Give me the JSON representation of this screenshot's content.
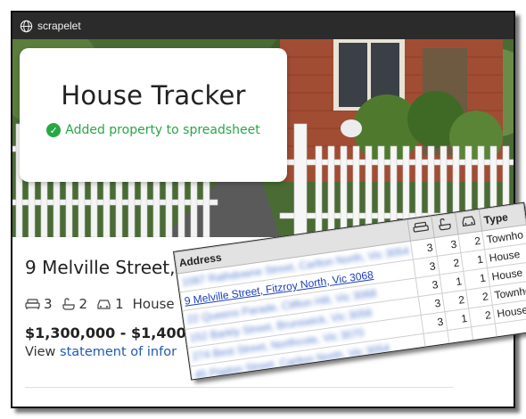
{
  "app": {
    "name": "scrapelet"
  },
  "card": {
    "title": "House Tracker",
    "status": "Added property to spreadsheet"
  },
  "listing": {
    "address": "9 Melville Street, Fitzroy North, Vi",
    "bedrooms": "3",
    "bathrooms": "2",
    "parking": "1",
    "type": "House",
    "price": "$1,300,000 - $1,400,",
    "statement_prefix": "View ",
    "statement_link": "statement of infor"
  },
  "spreadsheet": {
    "headers": {
      "address": "Address",
      "type": "Type"
    },
    "header_icons": [
      "bed-icon",
      "bath-icon",
      "car-icon"
    ],
    "rows": [
      {
        "address": "1087 Rathdowne Street, Carlton North, Vic 3054",
        "beds": "3",
        "baths": "3",
        "cars": "2",
        "type": "Townho",
        "blurred": true
      },
      {
        "address": "9 Melville Street, Fitzroy North, Vic 3068",
        "beds": "3",
        "baths": "2",
        "cars": "1",
        "type": "House",
        "blurred": false
      },
      {
        "address": "22 Queens Parade, Clifton Hill, Vic 3068",
        "beds": "3",
        "baths": "1",
        "cars": "1",
        "type": "House",
        "blurred": true
      },
      {
        "address": "152 Barkly Street, Brunswick, Vic 3056",
        "beds": "3",
        "baths": "2",
        "cars": "2",
        "type": "Townho",
        "blurred": true
      },
      {
        "address": "274 Best Street, Northcote, Vic 3070",
        "beds": "3",
        "baths": "1",
        "cars": "2",
        "type": "House",
        "blurred": true
      },
      {
        "address": "45 Pigdon Street, Carlton North, Vic 3054",
        "beds": "",
        "baths": "",
        "cars": "",
        "type": "",
        "blurred": true
      }
    ]
  }
}
